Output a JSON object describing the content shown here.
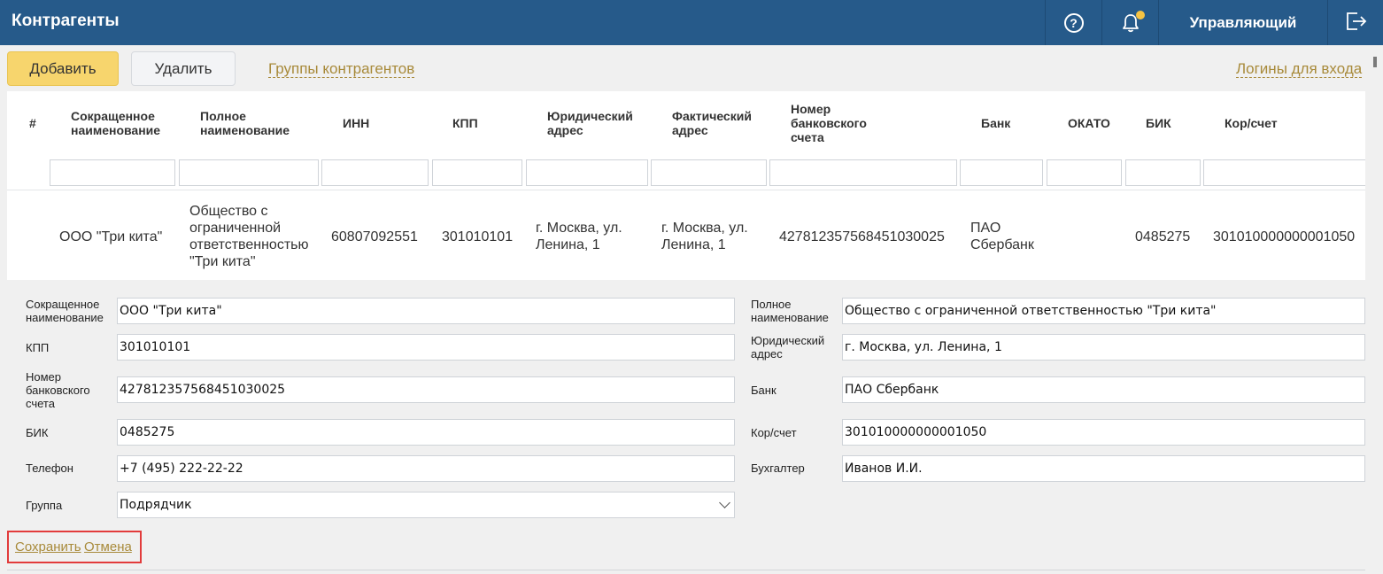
{
  "header": {
    "title": "Контрагенты",
    "help_label": "?",
    "user": "Управляющий"
  },
  "toolbar": {
    "add_label": "Добавить",
    "delete_label": "Удалить",
    "groups_link": "Группы контрагентов",
    "logins_link": "Логины для входа"
  },
  "table": {
    "columns": [
      "#",
      "Сокращенное наименование",
      "Полное наименование",
      "ИНН",
      "КПП",
      "Юридический адрес",
      "Фактический адрес",
      "Номер банковского счета",
      "Банк",
      "ОКАТО",
      "БИК",
      "Кор/счет"
    ],
    "rows": [
      {
        "num": "",
        "short_name": "ООО \"Три кита\"",
        "full_name": "Общество с ограниченной ответственностью \"Три кита\"",
        "inn": "60807092551",
        "kpp": "301010101",
        "legal_address": "г. Москва, ул. Ленина, 1",
        "actual_address": "г. Москва, ул. Ленина, 1",
        "account": "427812357568451030025",
        "bank": "ПАО Сбербанк",
        "okato": "",
        "bik": "0485275",
        "corr_account": "301010000000001050"
      }
    ]
  },
  "form": {
    "short_name": {
      "label": "Сокращенное наименование",
      "value": "ООО \"Три кита\""
    },
    "full_name": {
      "label": "Полное наименование",
      "value": "Общество с ограниченной ответственностью \"Три кита\""
    },
    "kpp": {
      "label": "КПП",
      "value": "301010101"
    },
    "legal_address": {
      "label": "Юридический адрес",
      "value": "г. Москва, ул. Ленина, 1"
    },
    "account": {
      "label": "Номер банковского счета",
      "value": "427812357568451030025"
    },
    "bank": {
      "label": "Банк",
      "value": "ПАО Сбербанк"
    },
    "bik": {
      "label": "БИК",
      "value": "0485275"
    },
    "corr_account": {
      "label": "Кор/счет",
      "value": "301010000000001050"
    },
    "phone": {
      "label": "Телефон",
      "value": "+7 (495) 222-22-22"
    },
    "accountant": {
      "label": "Бухгалтер",
      "value": "Иванов И.И."
    },
    "group": {
      "label": "Группа",
      "value": "Подрядчик"
    },
    "save_label": "Сохранить",
    "cancel_label": "Отмена"
  },
  "colors": {
    "header_bg": "#265a8a",
    "add_button": "#f7d56d",
    "link": "#a88a3a",
    "notification_dot": "#f6c343",
    "highlight_border": "#e23b3b"
  }
}
